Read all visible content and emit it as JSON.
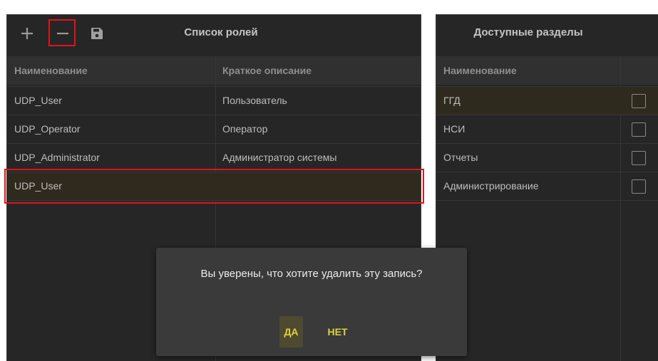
{
  "roles_panel": {
    "title": "Список ролей",
    "columns": [
      "Наименование",
      "Краткое описание"
    ],
    "rows": [
      {
        "name": "UDP_User",
        "description": "Пользователь"
      },
      {
        "name": "UDP_Operator",
        "description": "Оператор"
      },
      {
        "name": "UDP_Administrator",
        "description": "Администратор системы"
      },
      {
        "name": "UDP_User",
        "description": ""
      }
    ],
    "selected_row": 3
  },
  "sections_panel": {
    "title": "Доступные разделы",
    "columns": [
      "Наименование",
      ""
    ],
    "rows": [
      {
        "name": "ГГД",
        "checked": false
      },
      {
        "name": "НСИ",
        "checked": false
      },
      {
        "name": "Отчеты",
        "checked": false
      },
      {
        "name": "Администрирование",
        "checked": false
      }
    ],
    "selected_row": 0
  },
  "toolbar": {
    "icons": [
      "plus-icon",
      "minus-icon",
      "save-icon"
    ]
  },
  "dialog": {
    "message": "Вы уверены, что хотите удалить эту запись?",
    "yes_label": "ДА",
    "no_label": "НЕТ"
  },
  "colors": {
    "panel_bg": "#262626",
    "header_bg": "#303030",
    "selected_bg": "#2e2b1e",
    "accent": "#e1d13a",
    "highlight": "#e0141a"
  }
}
